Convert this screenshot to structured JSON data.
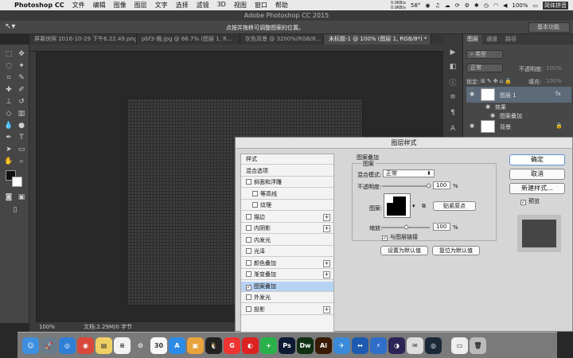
{
  "menubar": {
    "app_name": "Photoshop CC",
    "items": [
      "文件",
      "编辑",
      "图像",
      "图层",
      "文字",
      "选择",
      "滤镜",
      "3D",
      "视图",
      "窗口",
      "帮助"
    ],
    "net_speed": "0.0KB/s",
    "net_speed2": "0.0KB/s",
    "temp": "58°",
    "battery": "100%",
    "ime": "简体拼音"
  },
  "window": {
    "title": "Adobe Photoshop CC 2015"
  },
  "options_bar": {
    "hint": "点按并拖移可调整图案的位置。",
    "workspace": "基本功能"
  },
  "doc_tabs": [
    {
      "label": "屏幕快照 2016-10-29 下午6.22.49.png"
    },
    {
      "label": "pbf3-晚.jpg @ 66.7% (图层 1, R..."
    },
    {
      "label": "灰色背景 @ 3200%(RGB/8..."
    },
    {
      "label": "未标题-1 @ 100% (图层 1, RGB/8*) *"
    }
  ],
  "status_bar": {
    "zoom": "100%",
    "doc_info": "文档:2.29M/0 字节"
  },
  "layers_panel": {
    "tabs": [
      "图层",
      "通道",
      "路径"
    ],
    "kind_filter": "类型",
    "blend_mode": "正常",
    "opacity_label": "不透明度:",
    "opacity_value": "100%",
    "lock_label": "锁定:",
    "fill_label": "填充:",
    "fill_value": "100%",
    "layers": [
      {
        "name": "图层 1",
        "selected": true
      },
      {
        "name": "效果",
        "selected": false
      },
      {
        "name": "图案叠加",
        "selected": false
      },
      {
        "name": "背景",
        "selected": false
      }
    ]
  },
  "dialog": {
    "title": "图层样式",
    "style_list": [
      {
        "label": "样式",
        "checkbox": false,
        "plus": false,
        "selected": false
      },
      {
        "label": "混合选项",
        "checkbox": false,
        "plus": false,
        "selected": false
      },
      {
        "label": "斜面和浮雕",
        "checkbox": true,
        "checked": false,
        "plus": false,
        "selected": false
      },
      {
        "label": "等高线",
        "checkbox": true,
        "checked": false,
        "plus": false,
        "selected": false,
        "indent": true
      },
      {
        "label": "纹理",
        "checkbox": true,
        "checked": false,
        "plus": false,
        "selected": false,
        "indent": true
      },
      {
        "label": "描边",
        "checkbox": true,
        "checked": false,
        "plus": true,
        "selected": false
      },
      {
        "label": "内阴影",
        "checkbox": true,
        "checked": false,
        "plus": true,
        "selected": false
      },
      {
        "label": "内发光",
        "checkbox": true,
        "checked": false,
        "plus": false,
        "selected": false
      },
      {
        "label": "光泽",
        "checkbox": true,
        "checked": false,
        "plus": false,
        "selected": false
      },
      {
        "label": "颜色叠加",
        "checkbox": true,
        "checked": false,
        "plus": true,
        "selected": false
      },
      {
        "label": "渐变叠加",
        "checkbox": true,
        "checked": false,
        "plus": true,
        "selected": false
      },
      {
        "label": "图案叠加",
        "checkbox": true,
        "checked": true,
        "plus": false,
        "selected": true
      },
      {
        "label": "外发光",
        "checkbox": true,
        "checked": false,
        "plus": false,
        "selected": false
      },
      {
        "label": "投影",
        "checkbox": true,
        "checked": false,
        "plus": true,
        "selected": false
      }
    ],
    "section_title": "图案叠加",
    "group_title": "图案",
    "blend_mode_label": "混合模式:",
    "blend_mode_value": "正常",
    "opacity_label": "不透明度:",
    "opacity_value": "100",
    "opacity_unit": "%",
    "pattern_label": "图案:",
    "snap_origin": "贴紧原点",
    "scale_label": "缩放:",
    "scale_value": "100",
    "scale_unit": "%",
    "link_layer": "与图层链接",
    "set_default": "设置为默认值",
    "reset_default": "复位为默认值",
    "ok": "确定",
    "cancel": "取消",
    "new_style": "新建样式...",
    "preview": "预览"
  },
  "dock_apps": [
    {
      "name": "finder",
      "color": "#3d8fe0",
      "glyph": "☺"
    },
    {
      "name": "launchpad",
      "color": "#6a7b8c",
      "glyph": "🚀"
    },
    {
      "name": "safari",
      "color": "#2f7fd6",
      "glyph": "◎"
    },
    {
      "name": "chrome",
      "color": "#d9483b",
      "glyph": "◉"
    },
    {
      "name": "notes",
      "color": "#f0d064",
      "glyph": "▤"
    },
    {
      "name": "reminders",
      "color": "#f2f2f2",
      "glyph": "≡"
    },
    {
      "name": "preferences",
      "color": "#7a7a7a",
      "glyph": "⚙"
    },
    {
      "name": "calendar",
      "color": "#f8f8f8",
      "glyph": "30"
    },
    {
      "name": "app-store",
      "color": "#2d8be8",
      "glyph": "A"
    },
    {
      "name": "preview",
      "color": "#e8a33c",
      "glyph": "▣"
    },
    {
      "name": "qq",
      "color": "#222",
      "glyph": "🐧"
    },
    {
      "name": "weibo",
      "color": "#e33",
      "glyph": "G"
    },
    {
      "name": "netease",
      "color": "#d22",
      "glyph": "◐"
    },
    {
      "name": "plus-app",
      "color": "#2ab24a",
      "glyph": "+"
    },
    {
      "name": "photoshop",
      "color": "#0d1a33",
      "glyph": "Ps"
    },
    {
      "name": "dreamweaver",
      "color": "#103011",
      "glyph": "Dw"
    },
    {
      "name": "illustrator",
      "color": "#3a1a05",
      "glyph": "Ai"
    },
    {
      "name": "xcode-bird",
      "color": "#3b8ad9",
      "glyph": "✈"
    },
    {
      "name": "teamviewer",
      "color": "#1e5bb0",
      "glyph": "↔"
    },
    {
      "name": "thunder",
      "color": "#2f6ec9",
      "glyph": "⚡"
    },
    {
      "name": "eclipse",
      "color": "#2c2356",
      "glyph": "◑"
    },
    {
      "name": "mail-bird",
      "color": "#ddd",
      "glyph": "✉"
    },
    {
      "name": "steam",
      "color": "#1b2838",
      "glyph": "◎"
    },
    {
      "name": "terminal",
      "color": "#eee",
      "glyph": "▭"
    },
    {
      "name": "trash",
      "color": "#bbb",
      "glyph": "🗑"
    }
  ]
}
